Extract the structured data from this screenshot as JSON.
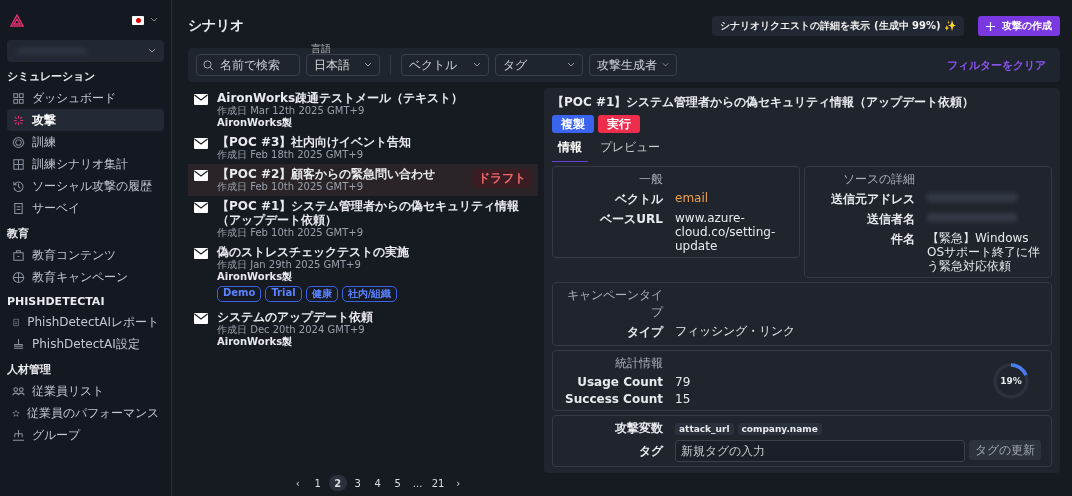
{
  "sidebar": {
    "sections": [
      {
        "title": "シミュレーション",
        "items": [
          {
            "label": "ダッシュボード",
            "selected": false
          },
          {
            "label": "攻撃",
            "selected": true
          },
          {
            "label": "訓練",
            "selected": false
          },
          {
            "label": "訓練シナリオ集計",
            "selected": false
          },
          {
            "label": "ソーシャル攻撃の履歴",
            "selected": false
          },
          {
            "label": "サーベイ",
            "selected": false
          }
        ]
      },
      {
        "title": "教育",
        "items": [
          {
            "label": "教育コンテンツ",
            "selected": false
          },
          {
            "label": "教育キャンペーン",
            "selected": false
          }
        ]
      },
      {
        "title": "PHISHDETECTAI",
        "items": [
          {
            "label": "PhishDetectAIレポート",
            "selected": false
          },
          {
            "label": "PhishDetectAI設定",
            "selected": false
          }
        ]
      },
      {
        "title": "人材管理",
        "items": [
          {
            "label": "従業員リスト",
            "selected": false
          },
          {
            "label": "従業員のパフォーマンス",
            "selected": false
          },
          {
            "label": "グループ",
            "selected": false
          }
        ]
      }
    ]
  },
  "header": {
    "title": "シナリオ",
    "request_button": "シナリオリクエストの詳細を表示 (生成中 99%) ✨",
    "create_button": "攻撃の作成"
  },
  "filters": {
    "search": {
      "placeholder": "名前で検索"
    },
    "language": {
      "label": "言語",
      "value": "日本語"
    },
    "vector": {
      "placeholder": "ベクトル"
    },
    "tag": {
      "placeholder": "タグ"
    },
    "creator": {
      "placeholder": "攻撃生成者"
    },
    "clear": "フィルターをクリア"
  },
  "scenarios": [
    {
      "title": "AironWorks疎通テストメール（テキスト）",
      "date": "作成日 Mar 12th 2025 GMT+9",
      "author": "AironWorks製",
      "selected": false
    },
    {
      "title": "【POC #3】社内向けイベント告知",
      "date": "作成日 Feb 18th 2025 GMT+9",
      "selected": false
    },
    {
      "title": "【POC #2】顧客からの緊急問い合わせ",
      "date": "作成日 Feb 10th 2025 GMT+9",
      "badge": "ドラフト",
      "selected": true
    },
    {
      "title": "【POC #1】システム管理者からの偽セキュリティ情報（アップデート依頼）",
      "date": "作成日 Feb 10th 2025 GMT+9",
      "selected": false
    },
    {
      "title": "偽のストレスチェックテストの実施",
      "date": "作成日 Jan 29th 2025 GMT+9",
      "author": "AironWorks製",
      "tags": [
        "Demo",
        "Trial",
        "健康",
        "社内/組織"
      ],
      "selected": false
    },
    {
      "title": "システムのアップデート依頼",
      "date": "作成日 Dec 20th 2024 GMT+9",
      "author": "AironWorks製",
      "selected": false
    }
  ],
  "pagination": {
    "prev": "‹",
    "next": "›",
    "pages": [
      {
        "label": "1",
        "selected": false
      },
      {
        "label": "2",
        "selected": true
      },
      {
        "label": "3",
        "selected": false
      },
      {
        "label": "4",
        "selected": false
      },
      {
        "label": "5",
        "selected": false
      },
      {
        "label": "...",
        "selected": false
      },
      {
        "label": "21",
        "selected": false
      }
    ]
  },
  "detail": {
    "title": "【POC #1】システム管理者からの偽セキュリティ情報（アップデート依頼）",
    "copy_button": "複製",
    "run_button": "実行",
    "tabs": [
      {
        "label": "情報",
        "selected": true
      },
      {
        "label": "プレビュー",
        "selected": false
      }
    ],
    "general": {
      "heading": "一般",
      "rows": [
        {
          "label": "ベクトル",
          "value": "email",
          "accent": true
        },
        {
          "label": "ベースURL",
          "value": "www.azure-cloud.co/setting-update",
          "accent": false
        }
      ]
    },
    "source": {
      "heading": "ソースの詳細",
      "rows": [
        {
          "label": "送信元アドレス",
          "redacted": true
        },
        {
          "label": "送信者名",
          "redacted": true
        },
        {
          "label": "件名",
          "value": "【緊急】Windows OSサポート終了に伴う緊急対応依頼",
          "redacted": false
        }
      ]
    },
    "campaign": {
      "heading": "キャンペーンタイプ",
      "rows": [
        {
          "label": "タイプ",
          "value": "フィッシング・リンク"
        }
      ]
    },
    "stats": {
      "heading": "統計情報",
      "rows": [
        {
          "label": "Usage Count",
          "value": "79"
        },
        {
          "label": "Success Count",
          "value": "15"
        }
      ],
      "rate": {
        "level": 0.19,
        "text": "19%"
      }
    },
    "variables": {
      "label": "攻撃変数",
      "chips": [
        "attack_url",
        "company.name"
      ]
    },
    "tags": {
      "label": "タグ",
      "placeholder": "新規タグの入力",
      "button": "タグの更新"
    }
  }
}
